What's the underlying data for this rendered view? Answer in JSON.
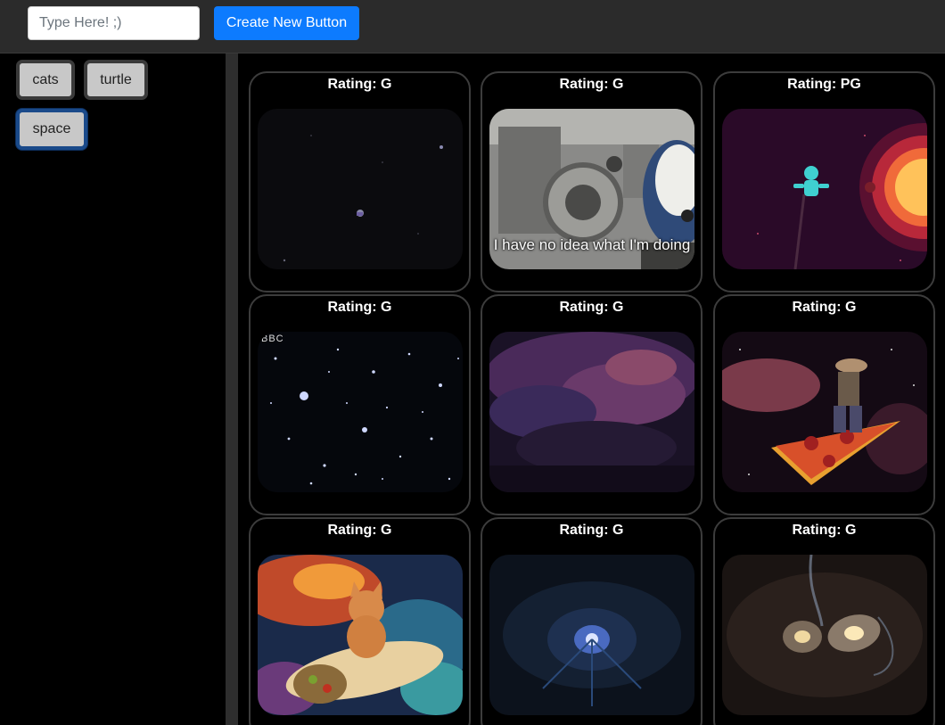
{
  "topbar": {
    "search_placeholder": "Type Here! ;)",
    "create_button_label": "Create New Button"
  },
  "sidebar": {
    "buttons": [
      {
        "label": "cats",
        "active": false
      },
      {
        "label": "turtle",
        "active": false
      },
      {
        "label": "space",
        "active": true
      }
    ]
  },
  "gifs": [
    {
      "rating": "Rating: G",
      "image": "tiny-astronaut-drifting-in-dark-space"
    },
    {
      "rating": "Rating: G",
      "image": "dog-in-space-station",
      "caption": "I have no idea what I'm doing"
    },
    {
      "rating": "Rating: PG",
      "image": "cartoon-astronaut-near-sun"
    },
    {
      "rating": "Rating: G",
      "image": "starfield",
      "watermark": "BBC"
    },
    {
      "rating": "Rating: G",
      "image": "purple-nebula"
    },
    {
      "rating": "Rating: G",
      "image": "cowboy-riding-pizza-in-space"
    },
    {
      "rating": "Rating: G",
      "image": "cat-riding-burrito-in-space"
    },
    {
      "rating": "Rating: G",
      "image": "blue-energy-burst"
    },
    {
      "rating": "Rating: G",
      "image": "colliding-galaxies"
    }
  ],
  "colors": {
    "accent": "#0d7bfe",
    "topbar": "#2b2b2b",
    "background": "#000000"
  }
}
